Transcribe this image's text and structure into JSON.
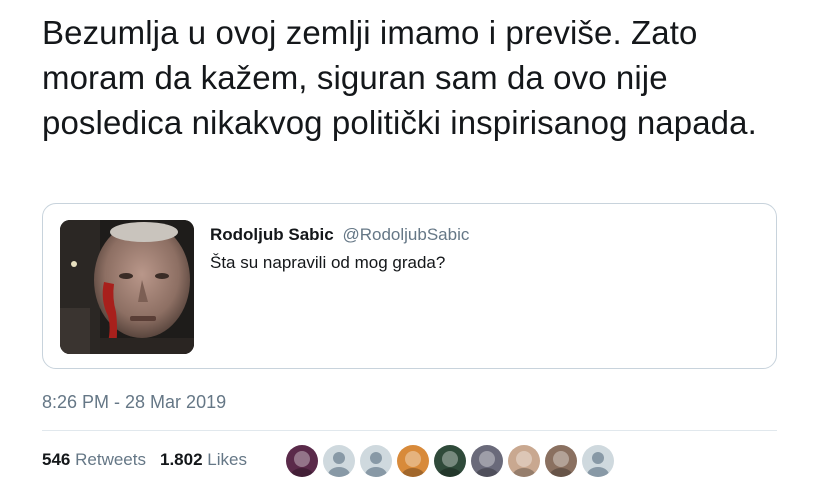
{
  "tweet": {
    "text": "Bezumlja u ovoj zemlji imamo i previše. Zato moram da kažem, siguran sam da ovo nije posledica nikakvog politički inspirisanog napada.",
    "timestamp": "8:26 PM - 28 Mar 2019"
  },
  "quoted_tweet": {
    "name": "Rodoljub Sabic",
    "handle": "@RodoljubSabic",
    "text": "Šta su napravili od mog grada?"
  },
  "stats": {
    "retweets_count": "546",
    "retweets_label": "Retweets",
    "likes_count": "1.802",
    "likes_label": "Likes"
  },
  "liker_avatars": [
    {
      "color": "#5a2a4a",
      "icon": "avatar-photo"
    },
    {
      "color": "#cfd9de",
      "icon": "default-avatar"
    },
    {
      "color": "#cfd9de",
      "icon": "default-avatar"
    },
    {
      "color": "#d88a3a",
      "icon": "avatar-photo"
    },
    {
      "color": "#2f4a3a",
      "icon": "avatar-photo"
    },
    {
      "color": "#6a6a7a",
      "icon": "avatar-photo"
    },
    {
      "color": "#c9a890",
      "icon": "avatar-photo"
    },
    {
      "color": "#8a7060",
      "icon": "avatar-photo"
    },
    {
      "color": "#cfd9de",
      "icon": "default-avatar"
    }
  ]
}
